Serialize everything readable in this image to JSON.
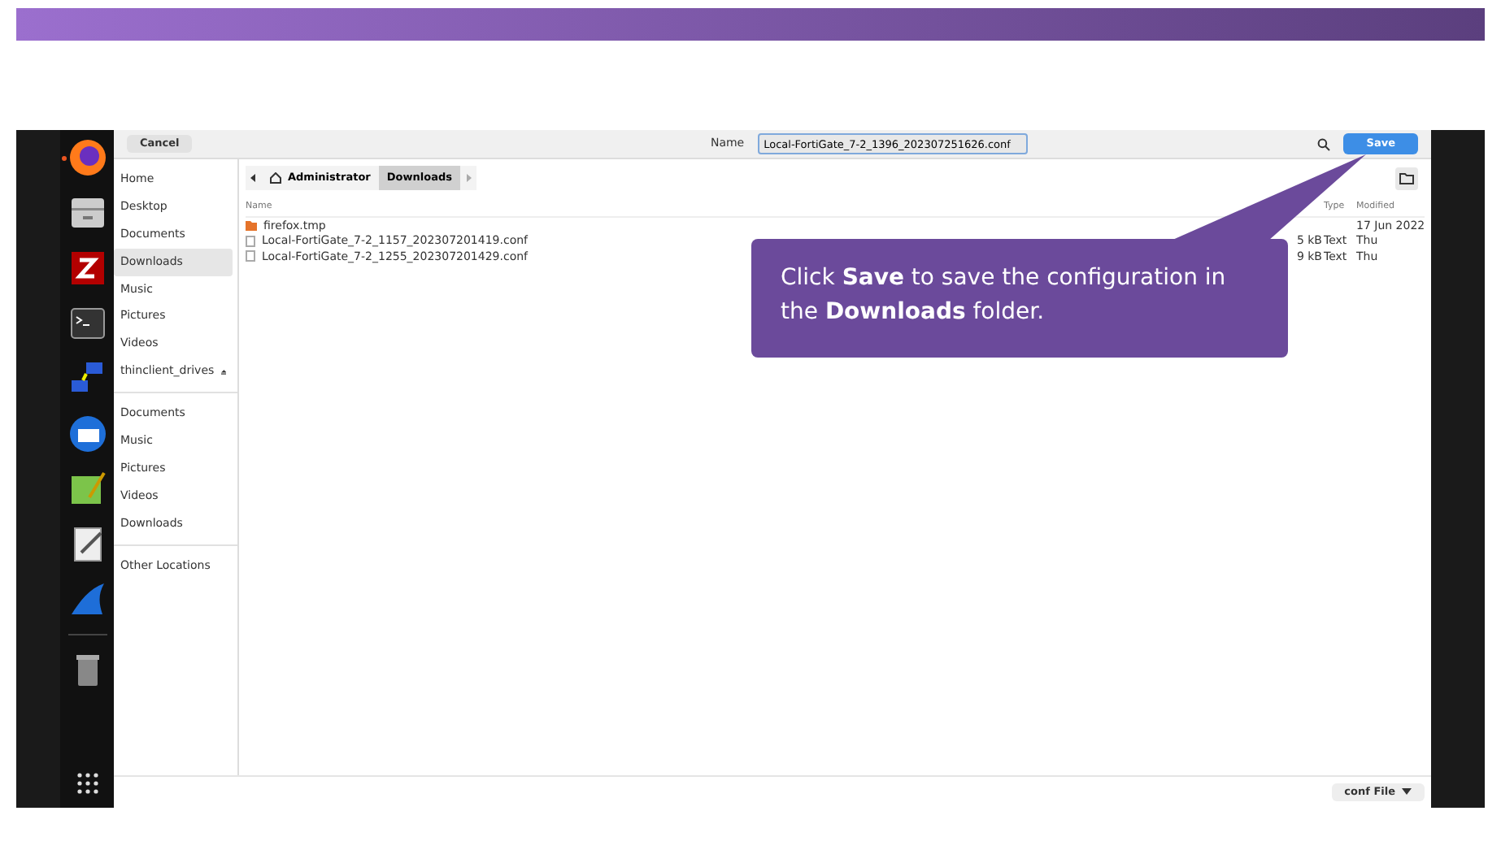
{
  "dock": {
    "apps": [
      {
        "kind": "browser",
        "running": true
      },
      {
        "kind": "files",
        "running": false
      },
      {
        "kind": "ftp",
        "running": false
      },
      {
        "kind": "terminal",
        "running": false
      },
      {
        "kind": "network",
        "running": false
      },
      {
        "kind": "mail",
        "running": false
      },
      {
        "kind": "image",
        "running": false
      },
      {
        "kind": "editor",
        "running": false
      },
      {
        "kind": "shark",
        "running": false
      },
      {
        "kind": "trash",
        "running": false
      }
    ]
  },
  "dialog": {
    "cancel": "Cancel",
    "name_label": "Name",
    "file_name": "Local-FortiGate_7-2_1396_202307251626.conf",
    "save": "Save",
    "sidebar": [
      {
        "kind": "place",
        "label": "Home",
        "selected": false
      },
      {
        "kind": "place",
        "label": "Desktop",
        "selected": false
      },
      {
        "kind": "place",
        "label": "Documents",
        "selected": false
      },
      {
        "kind": "place",
        "label": "Downloads",
        "selected": true
      },
      {
        "kind": "place",
        "label": "Music",
        "selected": false
      },
      {
        "kind": "place",
        "label": "Pictures",
        "selected": false
      },
      {
        "kind": "place",
        "label": "Videos",
        "selected": false
      },
      {
        "kind": "drive",
        "label": "thinclient_drives",
        "selected": false
      },
      {
        "kind": "separator"
      },
      {
        "kind": "place",
        "label": "Documents",
        "selected": false
      },
      {
        "kind": "place",
        "label": "Music",
        "selected": false
      },
      {
        "kind": "place",
        "label": "Pictures",
        "selected": false
      },
      {
        "kind": "place",
        "label": "Videos",
        "selected": false
      },
      {
        "kind": "place",
        "label": "Downloads",
        "selected": false
      },
      {
        "kind": "separator"
      },
      {
        "kind": "place",
        "label": "Other Locations",
        "selected": false
      }
    ],
    "breadcrumb": [
      {
        "label": "Administrator",
        "home": true,
        "selected": false
      },
      {
        "label": "Downloads",
        "home": false,
        "selected": true
      }
    ],
    "columns": {
      "name": "Name",
      "type": "Type",
      "modified": "Modified"
    },
    "files": [
      {
        "kind": "folder",
        "name": "firefox.tmp",
        "modified": "17 Jun 2022"
      },
      {
        "kind": "file",
        "name": "Local-FortiGate_7-2_1157_202307201419.conf",
        "size": "5 kB",
        "type": "Text",
        "modified": "Thu"
      },
      {
        "kind": "file",
        "name": "Local-FortiGate_7-2_1255_202307201429.conf",
        "size": "9 kB",
        "type": "Text",
        "modified": "Thu"
      }
    ],
    "filter": "conf File"
  },
  "callout": "Click **Save** to save the configuration in the **Downloads** folder."
}
